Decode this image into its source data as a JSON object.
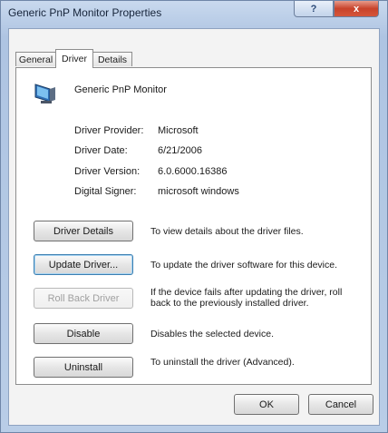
{
  "window": {
    "title": "Generic PnP Monitor Properties",
    "help_label": "?",
    "close_label": "x"
  },
  "tabs": [
    {
      "label": "General"
    },
    {
      "label": "Driver",
      "active": true
    },
    {
      "label": "Details"
    }
  ],
  "device": {
    "name": "Generic PnP Monitor",
    "icon": "monitor-icon"
  },
  "driver_info": [
    {
      "label": "Driver Provider:",
      "value": "Microsoft"
    },
    {
      "label": "Driver Date:",
      "value": "6/21/2006"
    },
    {
      "label": "Driver Version:",
      "value": "6.0.6000.16386"
    },
    {
      "label": "Digital Signer:",
      "value": "microsoft windows"
    }
  ],
  "actions": [
    {
      "label": "Driver Details",
      "description": "To view details about the driver files."
    },
    {
      "label": "Update Driver...",
      "description": "To update the driver software for this device."
    },
    {
      "label": "Roll Back Driver",
      "description": "If the device fails after updating the driver, roll back to the previously installed driver."
    },
    {
      "label": "Disable",
      "description": "Disables the selected device."
    },
    {
      "label": "Uninstall",
      "description": "To uninstall the driver (Advanced)."
    }
  ],
  "footer": {
    "ok_label": "OK",
    "cancel_label": "Cancel"
  },
  "colors": {
    "window_frame": "#aec4e2",
    "close_button": "#c8432b",
    "focus_border": "#3c7fb1"
  }
}
